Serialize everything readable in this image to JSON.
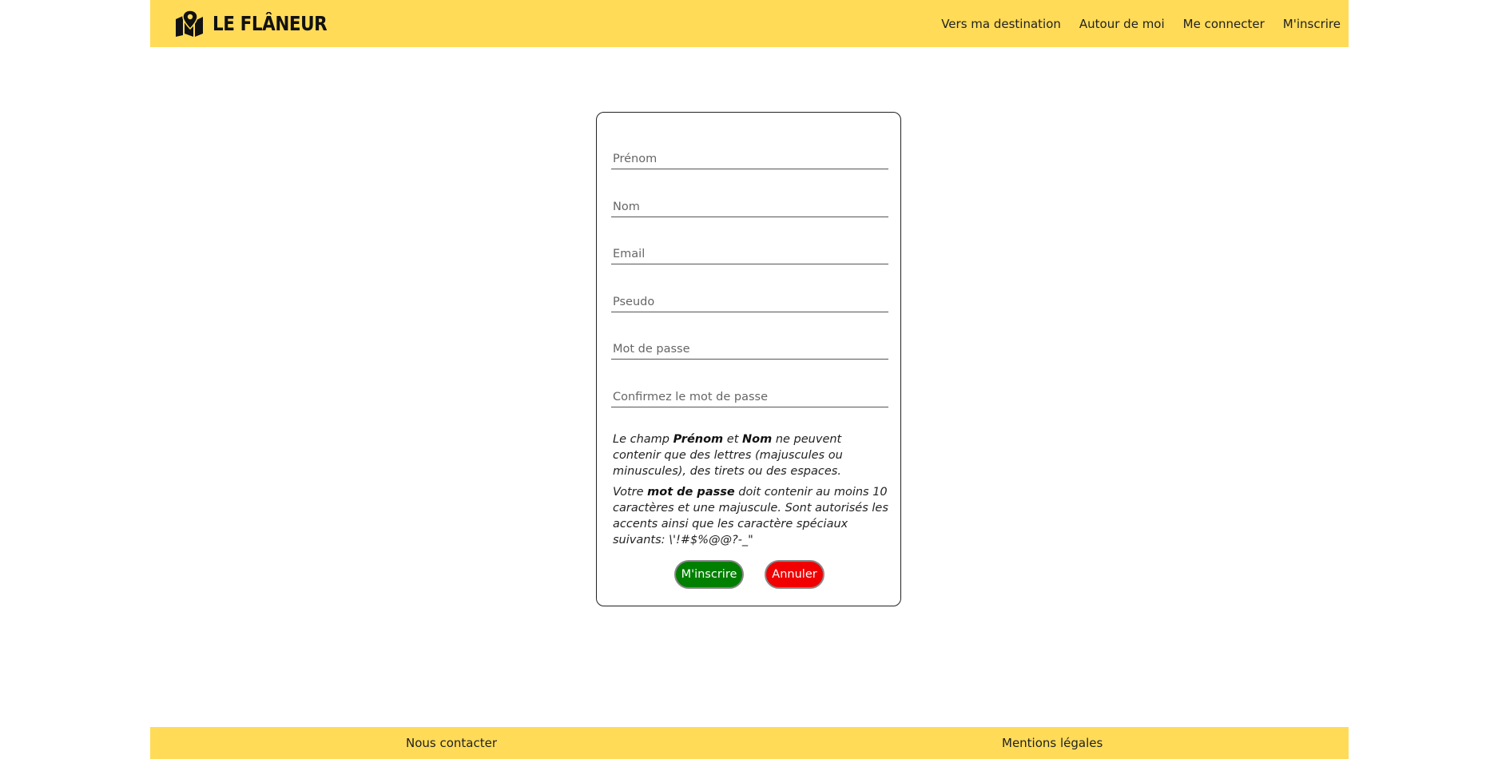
{
  "header": {
    "brand": "LE FLÂNEUR",
    "logo_icon": "map-pin-icon",
    "nav": [
      {
        "label": "Vers ma destination"
      },
      {
        "label": "Autour de moi"
      },
      {
        "label": "Me connecter"
      },
      {
        "label": "M'inscrire"
      }
    ]
  },
  "form": {
    "fields": {
      "firstname": {
        "placeholder": "Prénom",
        "value": ""
      },
      "lastname": {
        "placeholder": "Nom",
        "value": ""
      },
      "email": {
        "placeholder": "Email",
        "value": ""
      },
      "username": {
        "placeholder": "Pseudo",
        "value": ""
      },
      "password": {
        "placeholder": "Mot de passe",
        "value": ""
      },
      "password_confirm": {
        "placeholder": "Confirmez le mot de passe",
        "value": ""
      }
    },
    "hint_names": {
      "t1": "Le champ ",
      "b1": "Prénom",
      "t2": " et ",
      "b2": "Nom",
      "t3": " ne peuvent contenir que des lettres (majuscules ou minuscules), des tirets ou des espaces."
    },
    "hint_password": {
      "t1": "Votre ",
      "b1": "mot de passe",
      "t2": " doit contenir au moins 10 caractères et une majuscule. Sont autorisés les accents ainsi que les caractère spéciaux suivants: \\'!#$%@@?-_\""
    },
    "submit_label": "M'inscrire",
    "cancel_label": "Annuler"
  },
  "footer": {
    "contact": "Nous contacter",
    "legal": "Mentions légales"
  },
  "colors": {
    "brand_yellow": "#ffdb58",
    "submit_green": "#007f00",
    "cancel_red": "#f00000"
  }
}
